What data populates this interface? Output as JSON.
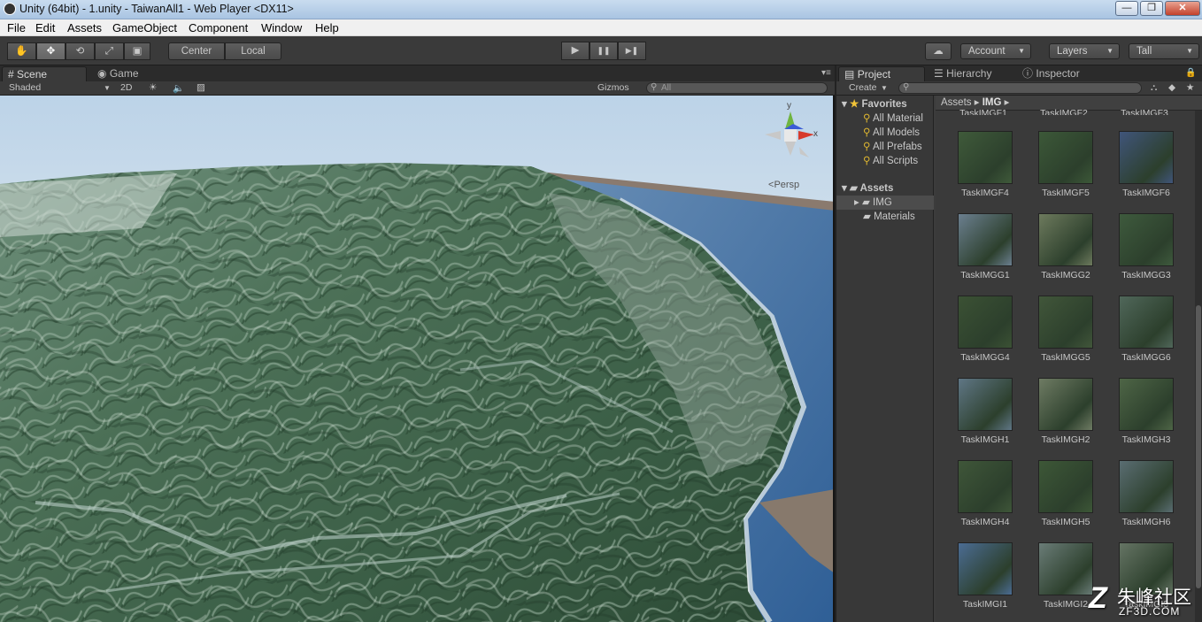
{
  "window": {
    "title": "Unity (64bit) - 1.unity - TaiwanAll1 - Web Player <DX11>",
    "minimize": "—",
    "maximize": "❐",
    "close": "✕"
  },
  "menu": [
    "File",
    "Edit",
    "Assets",
    "GameObject",
    "Component",
    "Window",
    "Help"
  ],
  "toolbar": {
    "tools": [
      "hand-icon",
      "move-icon",
      "rotate-icon",
      "scale-icon",
      "rect-icon"
    ],
    "tool_glyphs": [
      "✋",
      "✥",
      "⟲",
      "⤢",
      "▣"
    ],
    "pivot": "Center",
    "space": "Local",
    "play": "▶",
    "pause": "❚❚",
    "step": "▶❚",
    "cloud": "☁",
    "account": "Account",
    "layers": "Layers",
    "layout": "Tall"
  },
  "scene_panel": {
    "tabs": [
      "Scene",
      "Game"
    ],
    "shading": "Shaded",
    "mode_2d": "2D",
    "gizmos": "Gizmos",
    "search_placeholder": "All",
    "gizmo_y": "y",
    "gizmo_x": "x",
    "projection": "Persp"
  },
  "right_panel": {
    "tabs": [
      "Project",
      "Hierarchy",
      "Inspector"
    ],
    "create": "Create",
    "favorites_title": "Favorites",
    "favorites": [
      "All Material",
      "All Models",
      "All Prefabs",
      "All Scripts"
    ],
    "assets_title": "Assets",
    "folders": [
      "IMG",
      "Materials"
    ],
    "breadcrumb_root": "Assets",
    "breadcrumb_current": "IMG",
    "top_partial_labels": [
      "TaskIMGF1",
      "TaskIMGF2",
      "TaskIMGF3"
    ],
    "tiles": [
      {
        "label": "TaskIMGF4",
        "color": "#3f5a3a"
      },
      {
        "label": "TaskIMGF5",
        "color": "#3c5838"
      },
      {
        "label": "TaskIMGF6",
        "color": "#40557a"
      },
      {
        "label": "TaskIMGG1",
        "color": "#6b7f8f"
      },
      {
        "label": "TaskIMGG2",
        "color": "#6d7a5d"
      },
      {
        "label": "TaskIMGG3",
        "color": "#3e5a3d"
      },
      {
        "label": "TaskIMGG4",
        "color": "#3b5134"
      },
      {
        "label": "TaskIMGG5",
        "color": "#41563a"
      },
      {
        "label": "TaskIMGG6",
        "color": "#50675a"
      },
      {
        "label": "TaskIMGH1",
        "color": "#5f7685"
      },
      {
        "label": "TaskIMGH2",
        "color": "#6e7b63"
      },
      {
        "label": "TaskIMGH3",
        "color": "#4e6546"
      },
      {
        "label": "TaskIMGH4",
        "color": "#3f5639"
      },
      {
        "label": "TaskIMGH5",
        "color": "#3d5737"
      },
      {
        "label": "TaskIMGH6",
        "color": "#5a6d72"
      },
      {
        "label": "TaskIMGI1",
        "color": "#4b6c93"
      },
      {
        "label": "TaskIMGI2",
        "color": "#6a7c77"
      },
      {
        "label": "TaskIMGI3",
        "color": "#657464"
      }
    ]
  },
  "watermark": {
    "logo": "Z",
    "text": "朱峰社区",
    "sub": "ZF3D.COM"
  }
}
